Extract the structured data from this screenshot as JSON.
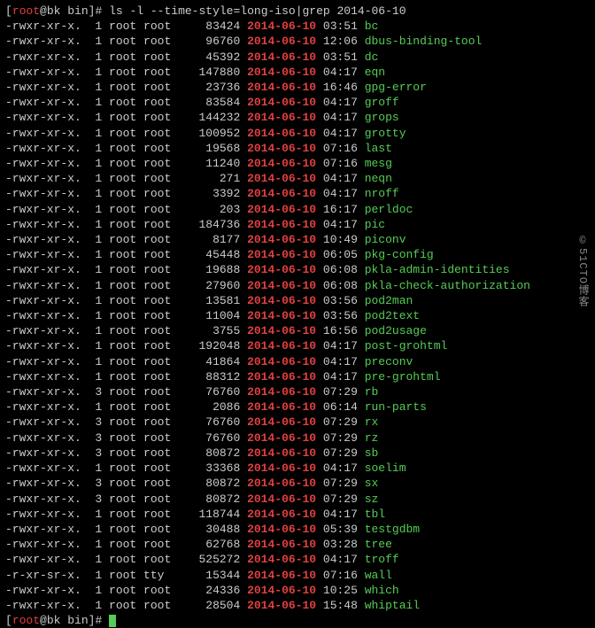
{
  "prompt": {
    "user": "root",
    "host": "bk",
    "path": "bin",
    "open": "[",
    "close": "]#",
    "at": "@"
  },
  "command": "ls -l --time-style=long-iso|grep 2014-06-10",
  "rows": [
    {
      "perms": "-rwxr-xr-x.",
      "links": "1",
      "owner": "root",
      "group": "root",
      "size": "83424",
      "date": "2014-06-10",
      "time": "03:51",
      "name": "bc",
      "exec": true
    },
    {
      "perms": "-rwxr-xr-x.",
      "links": "1",
      "owner": "root",
      "group": "root",
      "size": "96760",
      "date": "2014-06-10",
      "time": "12:06",
      "name": "dbus-binding-tool",
      "exec": true
    },
    {
      "perms": "-rwxr-xr-x.",
      "links": "1",
      "owner": "root",
      "group": "root",
      "size": "45392",
      "date": "2014-06-10",
      "time": "03:51",
      "name": "dc",
      "exec": true
    },
    {
      "perms": "-rwxr-xr-x.",
      "links": "1",
      "owner": "root",
      "group": "root",
      "size": "147880",
      "date": "2014-06-10",
      "time": "04:17",
      "name": "eqn",
      "exec": true
    },
    {
      "perms": "-rwxr-xr-x.",
      "links": "1",
      "owner": "root",
      "group": "root",
      "size": "23736",
      "date": "2014-06-10",
      "time": "16:46",
      "name": "gpg-error",
      "exec": true
    },
    {
      "perms": "-rwxr-xr-x.",
      "links": "1",
      "owner": "root",
      "group": "root",
      "size": "83584",
      "date": "2014-06-10",
      "time": "04:17",
      "name": "groff",
      "exec": true
    },
    {
      "perms": "-rwxr-xr-x.",
      "links": "1",
      "owner": "root",
      "group": "root",
      "size": "144232",
      "date": "2014-06-10",
      "time": "04:17",
      "name": "grops",
      "exec": true
    },
    {
      "perms": "-rwxr-xr-x.",
      "links": "1",
      "owner": "root",
      "group": "root",
      "size": "100952",
      "date": "2014-06-10",
      "time": "04:17",
      "name": "grotty",
      "exec": true
    },
    {
      "perms": "-rwxr-xr-x.",
      "links": "1",
      "owner": "root",
      "group": "root",
      "size": "19568",
      "date": "2014-06-10",
      "time": "07:16",
      "name": "last",
      "exec": true
    },
    {
      "perms": "-rwxr-xr-x.",
      "links": "1",
      "owner": "root",
      "group": "root",
      "size": "11240",
      "date": "2014-06-10",
      "time": "07:16",
      "name": "mesg",
      "exec": true
    },
    {
      "perms": "-rwxr-xr-x.",
      "links": "1",
      "owner": "root",
      "group": "root",
      "size": "271",
      "date": "2014-06-10",
      "time": "04:17",
      "name": "neqn",
      "exec": true
    },
    {
      "perms": "-rwxr-xr-x.",
      "links": "1",
      "owner": "root",
      "group": "root",
      "size": "3392",
      "date": "2014-06-10",
      "time": "04:17",
      "name": "nroff",
      "exec": true
    },
    {
      "perms": "-rwxr-xr-x.",
      "links": "1",
      "owner": "root",
      "group": "root",
      "size": "203",
      "date": "2014-06-10",
      "time": "16:17",
      "name": "perldoc",
      "exec": true
    },
    {
      "perms": "-rwxr-xr-x.",
      "links": "1",
      "owner": "root",
      "group": "root",
      "size": "184736",
      "date": "2014-06-10",
      "time": "04:17",
      "name": "pic",
      "exec": true
    },
    {
      "perms": "-rwxr-xr-x.",
      "links": "1",
      "owner": "root",
      "group": "root",
      "size": "8177",
      "date": "2014-06-10",
      "time": "10:49",
      "name": "piconv",
      "exec": true
    },
    {
      "perms": "-rwxr-xr-x.",
      "links": "1",
      "owner": "root",
      "group": "root",
      "size": "45448",
      "date": "2014-06-10",
      "time": "06:05",
      "name": "pkg-config",
      "exec": true
    },
    {
      "perms": "-rwxr-xr-x.",
      "links": "1",
      "owner": "root",
      "group": "root",
      "size": "19688",
      "date": "2014-06-10",
      "time": "06:08",
      "name": "pkla-admin-identities",
      "exec": true
    },
    {
      "perms": "-rwxr-xr-x.",
      "links": "1",
      "owner": "root",
      "group": "root",
      "size": "27960",
      "date": "2014-06-10",
      "time": "06:08",
      "name": "pkla-check-authorization",
      "exec": true
    },
    {
      "perms": "-rwxr-xr-x.",
      "links": "1",
      "owner": "root",
      "group": "root",
      "size": "13581",
      "date": "2014-06-10",
      "time": "03:56",
      "name": "pod2man",
      "exec": true
    },
    {
      "perms": "-rwxr-xr-x.",
      "links": "1",
      "owner": "root",
      "group": "root",
      "size": "11004",
      "date": "2014-06-10",
      "time": "03:56",
      "name": "pod2text",
      "exec": true
    },
    {
      "perms": "-rwxr-xr-x.",
      "links": "1",
      "owner": "root",
      "group": "root",
      "size": "3755",
      "date": "2014-06-10",
      "time": "16:56",
      "name": "pod2usage",
      "exec": true
    },
    {
      "perms": "-rwxr-xr-x.",
      "links": "1",
      "owner": "root",
      "group": "root",
      "size": "192048",
      "date": "2014-06-10",
      "time": "04:17",
      "name": "post-grohtml",
      "exec": true
    },
    {
      "perms": "-rwxr-xr-x.",
      "links": "1",
      "owner": "root",
      "group": "root",
      "size": "41864",
      "date": "2014-06-10",
      "time": "04:17",
      "name": "preconv",
      "exec": true
    },
    {
      "perms": "-rwxr-xr-x.",
      "links": "1",
      "owner": "root",
      "group": "root",
      "size": "88312",
      "date": "2014-06-10",
      "time": "04:17",
      "name": "pre-grohtml",
      "exec": true
    },
    {
      "perms": "-rwxr-xr-x.",
      "links": "3",
      "owner": "root",
      "group": "root",
      "size": "76760",
      "date": "2014-06-10",
      "time": "07:29",
      "name": "rb",
      "exec": true
    },
    {
      "perms": "-rwxr-xr-x.",
      "links": "1",
      "owner": "root",
      "group": "root",
      "size": "2086",
      "date": "2014-06-10",
      "time": "06:14",
      "name": "run-parts",
      "exec": true
    },
    {
      "perms": "-rwxr-xr-x.",
      "links": "3",
      "owner": "root",
      "group": "root",
      "size": "76760",
      "date": "2014-06-10",
      "time": "07:29",
      "name": "rx",
      "exec": true
    },
    {
      "perms": "-rwxr-xr-x.",
      "links": "3",
      "owner": "root",
      "group": "root",
      "size": "76760",
      "date": "2014-06-10",
      "time": "07:29",
      "name": "rz",
      "exec": true
    },
    {
      "perms": "-rwxr-xr-x.",
      "links": "3",
      "owner": "root",
      "group": "root",
      "size": "80872",
      "date": "2014-06-10",
      "time": "07:29",
      "name": "sb",
      "exec": true
    },
    {
      "perms": "-rwxr-xr-x.",
      "links": "1",
      "owner": "root",
      "group": "root",
      "size": "33368",
      "date": "2014-06-10",
      "time": "04:17",
      "name": "soelim",
      "exec": true
    },
    {
      "perms": "-rwxr-xr-x.",
      "links": "3",
      "owner": "root",
      "group": "root",
      "size": "80872",
      "date": "2014-06-10",
      "time": "07:29",
      "name": "sx",
      "exec": true
    },
    {
      "perms": "-rwxr-xr-x.",
      "links": "3",
      "owner": "root",
      "group": "root",
      "size": "80872",
      "date": "2014-06-10",
      "time": "07:29",
      "name": "sz",
      "exec": true
    },
    {
      "perms": "-rwxr-xr-x.",
      "links": "1",
      "owner": "root",
      "group": "root",
      "size": "118744",
      "date": "2014-06-10",
      "time": "04:17",
      "name": "tbl",
      "exec": true
    },
    {
      "perms": "-rwxr-xr-x.",
      "links": "1",
      "owner": "root",
      "group": "root",
      "size": "30488",
      "date": "2014-06-10",
      "time": "05:39",
      "name": "testgdbm",
      "exec": true
    },
    {
      "perms": "-rwxr-xr-x.",
      "links": "1",
      "owner": "root",
      "group": "root",
      "size": "62768",
      "date": "2014-06-10",
      "time": "03:28",
      "name": "tree",
      "exec": true
    },
    {
      "perms": "-rwxr-xr-x.",
      "links": "1",
      "owner": "root",
      "group": "root",
      "size": "525272",
      "date": "2014-06-10",
      "time": "04:17",
      "name": "troff",
      "exec": true
    },
    {
      "perms": "-r-xr-sr-x.",
      "links": "1",
      "owner": "root",
      "group": "tty",
      "size": "15344",
      "date": "2014-06-10",
      "time": "07:16",
      "name": "wall",
      "exec": true
    },
    {
      "perms": "-rwxr-xr-x.",
      "links": "1",
      "owner": "root",
      "group": "root",
      "size": "24336",
      "date": "2014-06-10",
      "time": "10:25",
      "name": "which",
      "exec": true
    },
    {
      "perms": "-rwxr-xr-x.",
      "links": "1",
      "owner": "root",
      "group": "root",
      "size": "28504",
      "date": "2014-06-10",
      "time": "15:48",
      "name": "whiptail",
      "exec": true
    }
  ],
  "watermark": "©51CTO博客"
}
